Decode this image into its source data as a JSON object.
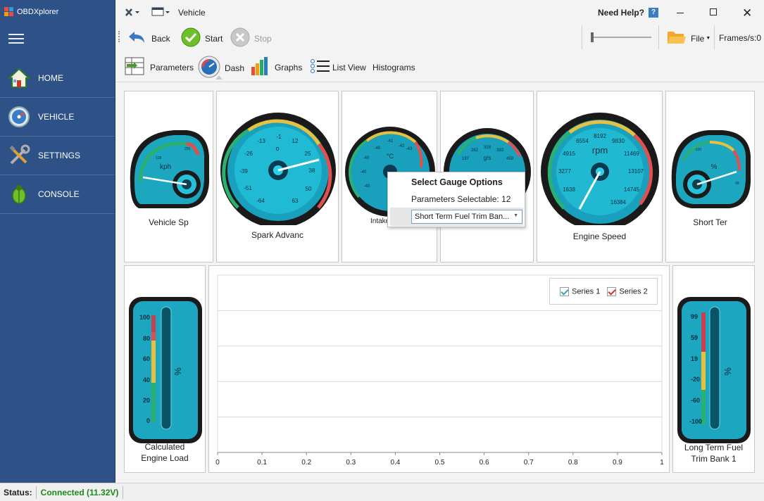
{
  "app": {
    "title": "OBDXplorer"
  },
  "sidebar": {
    "items": [
      {
        "label": "HOME",
        "icon": "home-icon"
      },
      {
        "label": "VEHICLE",
        "icon": "gauge-icon"
      },
      {
        "label": "SETTINGS",
        "icon": "tools-icon"
      },
      {
        "label": "CONSOLE",
        "icon": "bug-icon"
      }
    ]
  },
  "header": {
    "page_title": "Vehicle",
    "help_label": "Need Help?",
    "help_badge": "?"
  },
  "toolbar": {
    "back": "Back",
    "start": "Start",
    "stop": "Stop",
    "file": "File",
    "frames": "Frames/s:0"
  },
  "tabs": [
    {
      "label": "Parameters"
    },
    {
      "label": "Dash"
    },
    {
      "label": "Graphs"
    },
    {
      "label": "List View"
    },
    {
      "label": "Histograms"
    }
  ],
  "gauges": {
    "vehicle_speed": {
      "label": "Vehicle Sp",
      "unit": "kph",
      "ticks": [
        "255",
        "128"
      ]
    },
    "spark_advance": {
      "label": "Spark Advanc",
      "ticks": [
        "-1",
        "12",
        "25",
        "38",
        "50",
        "63",
        "-64",
        "-51",
        "-39",
        "-26",
        "-13"
      ],
      "unit": "o"
    },
    "intake": {
      "label": "Intake",
      "unit": "°C",
      "ticks": [
        "-41",
        "-42",
        "-43",
        "-44",
        "-40",
        "-40",
        "-40",
        "-40"
      ]
    },
    "maf": {
      "unit": "g/s",
      "ticks": [
        "262",
        "328",
        "393",
        "459",
        "197"
      ]
    },
    "engine_speed": {
      "label": "Engine Speed",
      "unit": "rpm",
      "ticks": [
        "8192",
        "9830",
        "11469",
        "13107",
        "14745",
        "16384",
        "6554",
        "4915",
        "3277",
        "1638"
      ]
    },
    "short_term": {
      "label": "Short Ter",
      "unit": "%",
      "ticks": [
        "-100",
        "-50",
        "0",
        "50",
        "99"
      ]
    },
    "calc_load": {
      "label_line1": "Calculated",
      "label_line2": "Engine Load",
      "unit": "%",
      "ticks": [
        "100",
        "80",
        "60",
        "40",
        "20",
        "0"
      ]
    },
    "long_term": {
      "label_line1": "Long Term Fuel",
      "label_line2": "Trim Bank 1",
      "unit": "%",
      "ticks": [
        "99",
        "59",
        "19",
        "-20",
        "-60",
        "-100"
      ]
    }
  },
  "popup": {
    "title": "Select Gauge Options",
    "subtitle": "Parameters Selectable: 12",
    "selected": "Short Term Fuel Trim Ban..."
  },
  "chart_data": {
    "type": "line",
    "x_ticks": [
      "0",
      "0.1",
      "0.2",
      "0.3",
      "0.4",
      "0.5",
      "0.6",
      "0.7",
      "0.8",
      "0.9",
      "1"
    ],
    "xlim": [
      0,
      1
    ],
    "series": [
      {
        "name": "Series 1",
        "values": [],
        "color": "#3a9ec0"
      },
      {
        "name": "Series 2",
        "values": [],
        "color": "#d0302f"
      }
    ],
    "legend": "top-right",
    "grid": true
  },
  "status": {
    "label": "Status:",
    "value": "Connected (11.32V)",
    "color": "#1a8a1a"
  }
}
